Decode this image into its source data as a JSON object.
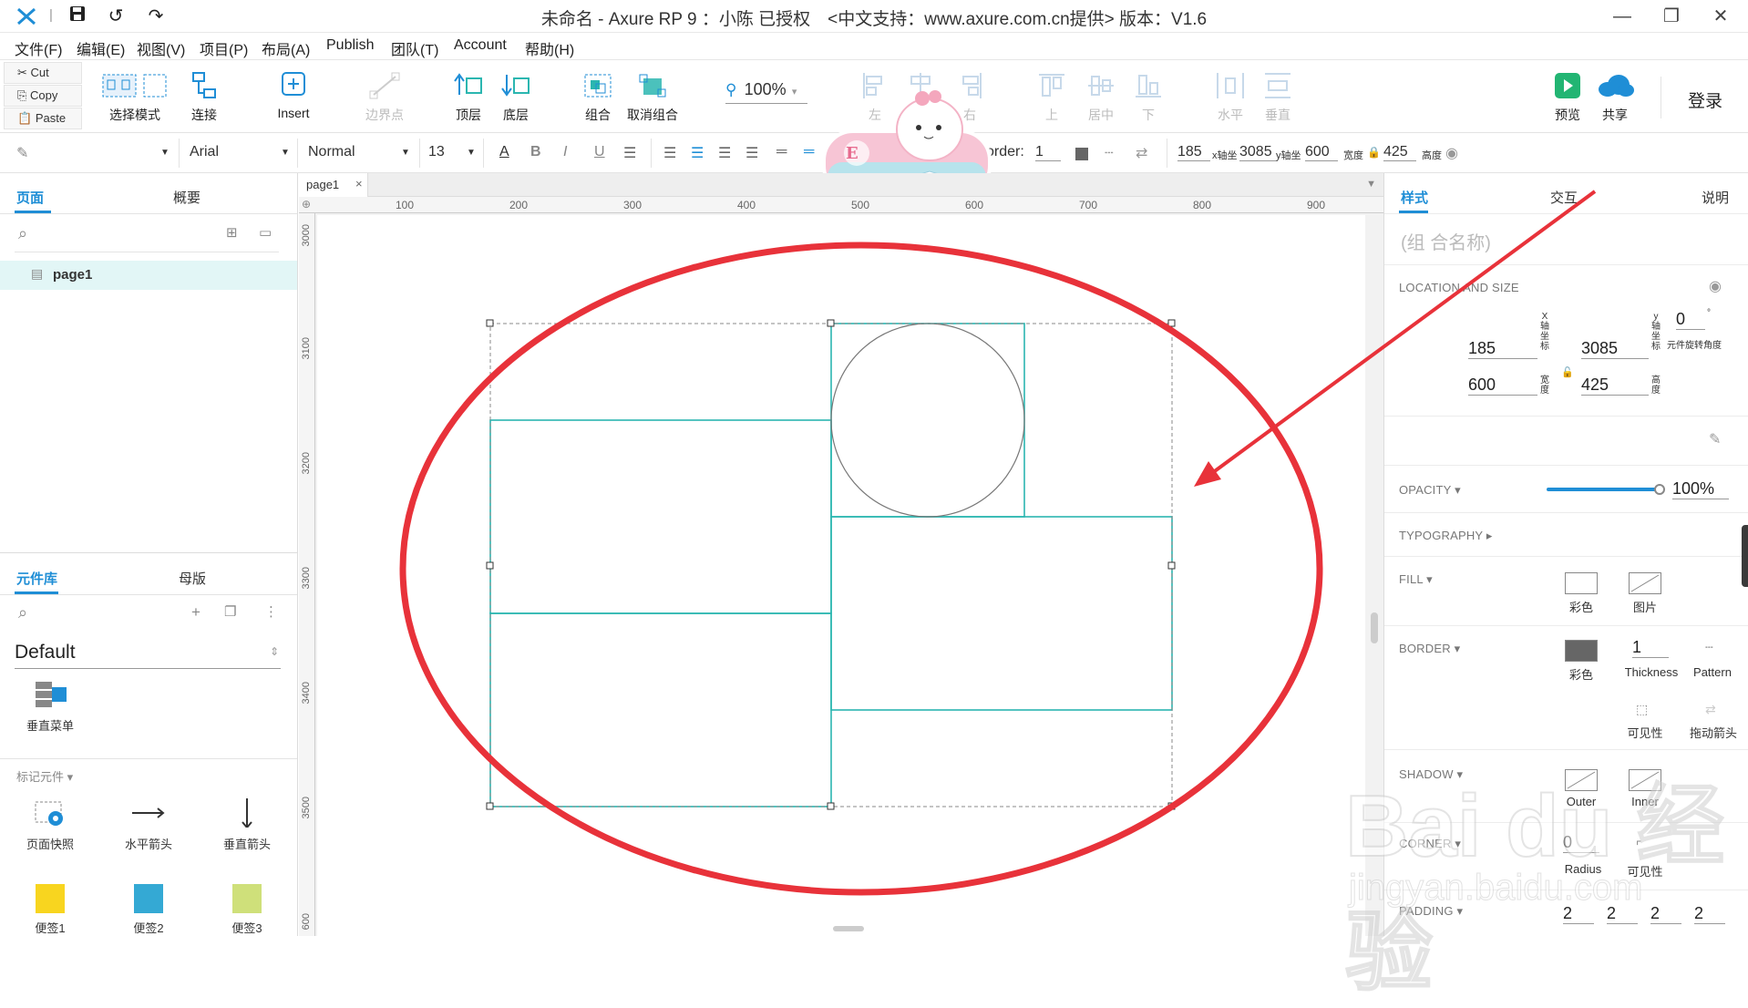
{
  "titlebar": {
    "title": "未命名 - Axure RP 9 ：小陈 已授权　<中文支持：www.axure.com.cn提供> 版本：V1.6"
  },
  "menu": [
    "文件(F)",
    "编辑(E)",
    "视图(V)",
    "项目(P)",
    "布局(A)",
    "Publish",
    "团队(T)",
    "Account",
    "帮助(H)"
  ],
  "clipboard": [
    "Cut",
    "Copy",
    "Paste"
  ],
  "toolbar": {
    "select_mode": "选择模式",
    "connect": "连接",
    "insert": "Insert",
    "points": "边界点",
    "top": "顶层",
    "bottom": "底层",
    "group": "组合",
    "ungroup": "取消组合",
    "zoom": "100%",
    "left": "左",
    "center": "居中",
    "right": "右",
    "vtop": "上",
    "vmiddle": "居中",
    "vbottom": "下",
    "horizontal": "水平",
    "vertical": "垂直",
    "preview": "预览",
    "share": "共享",
    "login": "登录"
  },
  "formatbar": {
    "font": "Arial",
    "style": "Normal",
    "size": "13",
    "border_label": "order:",
    "border_value": "1",
    "x": "185",
    "x_label": "x轴坐",
    "y": "3085",
    "y_label": "y轴坐",
    "w": "600",
    "w_label": "宽度",
    "h": "425",
    "h_label": "高度"
  },
  "left": {
    "tabs": [
      "页面",
      "概要"
    ],
    "pages": [
      "page1"
    ],
    "lib_tabs": [
      "元件库",
      "母版"
    ],
    "library": "Default",
    "widget_vmenu": "垂直菜单",
    "markup_header": "标记元件 ▾",
    "markup": [
      "页面快照",
      "水平箭头",
      "垂直箭头"
    ],
    "stickies": [
      "便签1",
      "便签2",
      "便签3"
    ]
  },
  "canvas": {
    "tab": "page1",
    "hruler": [
      "100",
      "200",
      "300",
      "400",
      "500",
      "600",
      "700",
      "800",
      "900"
    ],
    "vruler": [
      "3000",
      "3100",
      "3200",
      "3300",
      "3400",
      "3500",
      "600"
    ]
  },
  "right": {
    "tabs": [
      "样式",
      "交互",
      "说明"
    ],
    "name_placeholder": "(组 合名称)",
    "loc_header": "LOCATION AND SIZE",
    "x": "185",
    "y": "3085",
    "rot": "0",
    "w": "600",
    "h": "425",
    "x_lab": "X\n轴\n坐\n标",
    "y_lab": "y\n轴\n坐\n标",
    "w_lab": "宽\n度",
    "h_lab": "高\n度",
    "rot_lab": "元件旋转角度",
    "opacity_header": "OPACITY ▾",
    "opacity": "100%",
    "typography_header": "TYPOGRAPHY ▸",
    "fill_header": "FILL ▾",
    "fill_color": "彩色",
    "fill_image": "图片",
    "border_header": "BORDER ▾",
    "border_color": "彩色",
    "thickness": "1",
    "thickness_lab": "Thickness",
    "pattern": "Pattern",
    "visible": "可见性",
    "drag_arrow": "拖动箭头",
    "shadow_header": "SHADOW ▾",
    "shadow_outer": "Outer",
    "shadow_inner": "Inner",
    "corner_header": "CORNER ▾",
    "radius": "0",
    "radius_lab": "Radius",
    "corner_visible": "可见性",
    "padding_header": "PADDING ▾",
    "padding": [
      "2",
      "2",
      "2",
      "2"
    ]
  },
  "watermark": {
    "text": "jingyan.baidu.com"
  },
  "colors": {
    "accent": "#1f8ed6",
    "selection": "#2bb6b0",
    "annotation": "#e8323a"
  }
}
